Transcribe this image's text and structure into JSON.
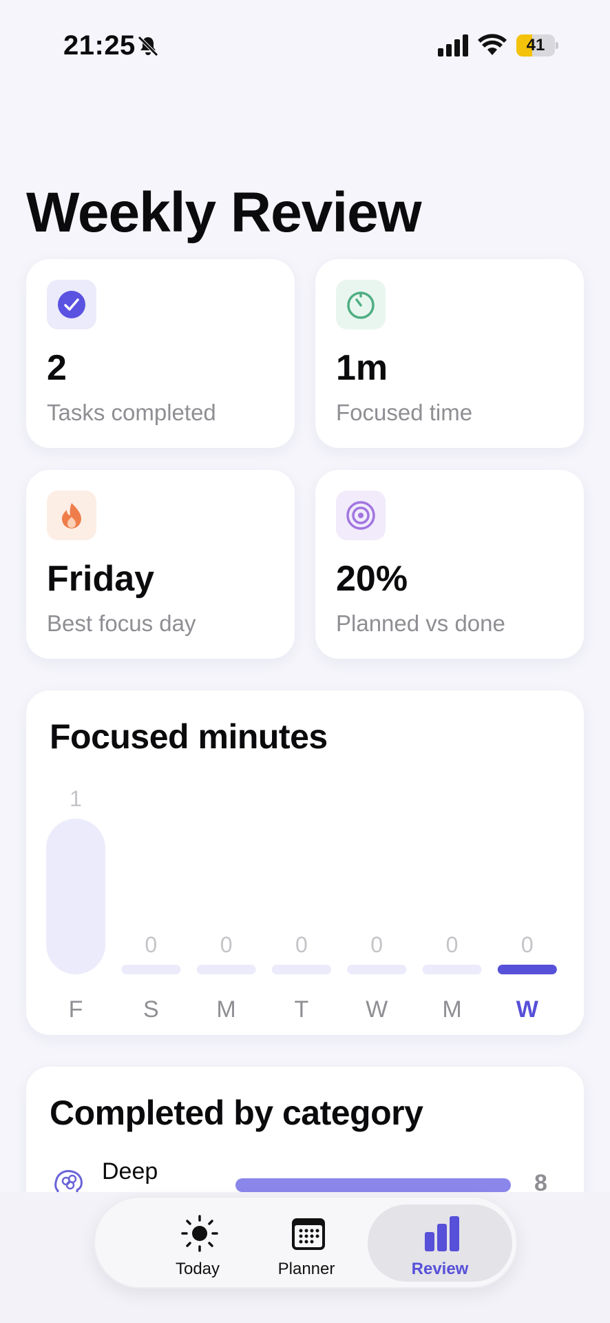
{
  "status_bar": {
    "time": "21:25",
    "battery": "41",
    "battery_fraction": 0.41
  },
  "page": {
    "title": "Weekly Review"
  },
  "stats": [
    {
      "value": "2",
      "label": "Tasks completed",
      "icon": "checkmark-circle-icon",
      "accent": "#5a52e0"
    },
    {
      "value": "1m",
      "label": "Focused time",
      "icon": "timer-icon",
      "accent": "#4fae82"
    },
    {
      "value": "Friday",
      "label": "Best focus day",
      "icon": "flame-icon",
      "accent": "#ee7d4a"
    },
    {
      "value": "20%",
      "label": "Planned vs done",
      "icon": "target-icon",
      "accent": "#a175e0"
    }
  ],
  "focus_chart": {
    "title": "Focused minutes",
    "chart_data": {
      "type": "bar",
      "categories": [
        "F",
        "S",
        "M",
        "T",
        "W",
        "M",
        "W"
      ],
      "values": [
        1,
        0,
        0,
        0,
        0,
        0,
        0
      ],
      "highlight_index": 6,
      "bar_color": "#ebebfb",
      "highlight_color": "#5750d8"
    }
  },
  "category_card": {
    "title": "Completed by category",
    "rows": [
      {
        "name": "Deep Work",
        "count": "8",
        "icon": "brain-icon",
        "fraction": 1.0
      }
    ]
  },
  "tabbar": {
    "tabs": [
      {
        "label": "Today",
        "icon": "sun-icon",
        "active": false
      },
      {
        "label": "Planner",
        "icon": "calendar-icon",
        "active": false
      },
      {
        "label": "Review",
        "icon": "bar-chart-icon",
        "active": true
      }
    ]
  }
}
